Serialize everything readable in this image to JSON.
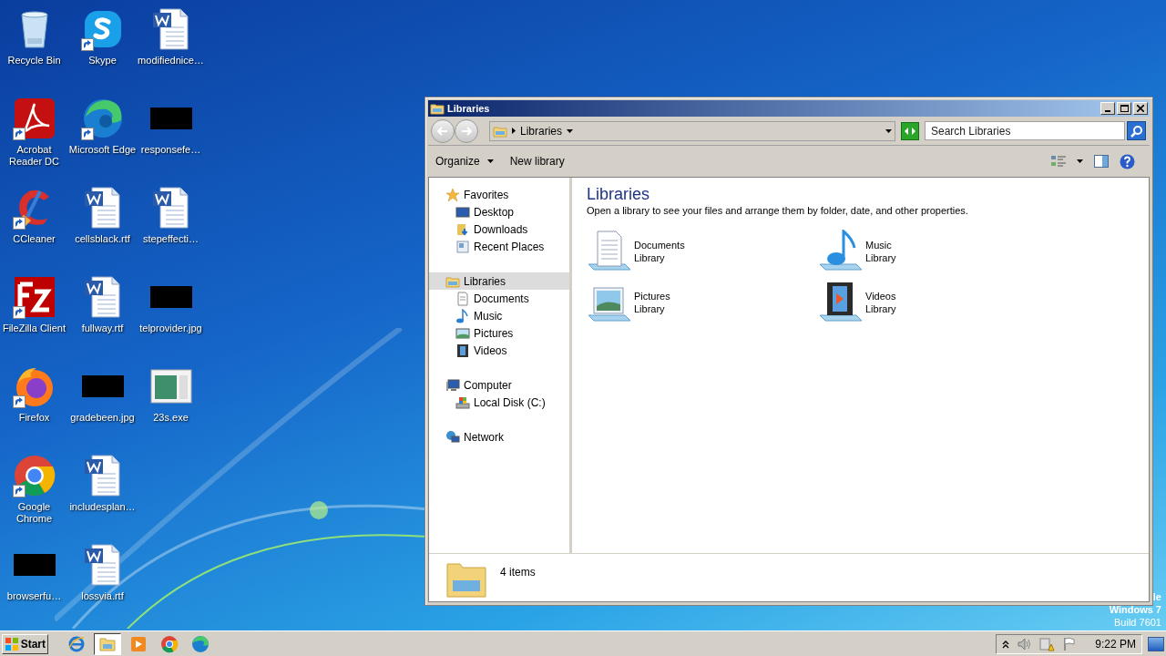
{
  "desktop": {
    "columns": [
      [
        {
          "label": "Recycle Bin",
          "kind": "recycle",
          "shortcut": false
        },
        {
          "label": "Acrobat Reader DC",
          "kind": "acrobat",
          "shortcut": true
        },
        {
          "label": "CCleaner",
          "kind": "ccleaner",
          "shortcut": true
        },
        {
          "label": "FileZilla Client",
          "kind": "filezilla",
          "shortcut": true
        },
        {
          "label": "Firefox",
          "kind": "firefox",
          "shortcut": true
        },
        {
          "label": "Google Chrome",
          "kind": "chrome",
          "shortcut": true
        },
        {
          "label": "browserfu…",
          "kind": "image",
          "shortcut": false
        }
      ],
      [
        {
          "label": "Skype",
          "kind": "skype",
          "shortcut": true
        },
        {
          "label": "Microsoft Edge",
          "kind": "edge",
          "shortcut": true
        },
        {
          "label": "cellsblack.rtf",
          "kind": "word",
          "shortcut": false
        },
        {
          "label": "fullway.rtf",
          "kind": "word",
          "shortcut": false
        },
        {
          "label": "gradebeen.jpg",
          "kind": "image",
          "shortcut": false
        },
        {
          "label": "includesplan…",
          "kind": "word",
          "shortcut": false
        },
        {
          "label": "lossvia.rtf",
          "kind": "word",
          "shortcut": false
        }
      ],
      [
        {
          "label": "modifiednice…",
          "kind": "word",
          "shortcut": false
        },
        {
          "label": "responsefe…",
          "kind": "image",
          "shortcut": false
        },
        {
          "label": "stepeffecti…",
          "kind": "word",
          "shortcut": false
        },
        {
          "label": "telprovider.jpg",
          "kind": "image",
          "shortcut": false
        },
        {
          "label": "23s.exe",
          "kind": "exe",
          "shortcut": false
        }
      ]
    ],
    "watermark": [
      "le",
      "Windows 7",
      "Build 7601"
    ]
  },
  "window": {
    "title": "Libraries",
    "address": {
      "crumbs": [
        "Libraries"
      ]
    },
    "search": {
      "placeholder": "Search Libraries"
    },
    "toolbar": [
      {
        "label": "Organize",
        "dropdown": true
      },
      {
        "label": "New library",
        "dropdown": false
      }
    ],
    "navigation": [
      {
        "label": "Favorites",
        "kind": "star",
        "selected": false,
        "children": [
          {
            "label": "Desktop",
            "kind": "desktop",
            "selected": false
          },
          {
            "label": "Downloads",
            "kind": "downloads",
            "selected": false
          },
          {
            "label": "Recent Places",
            "kind": "recent",
            "selected": false
          }
        ]
      },
      {
        "label": "Libraries",
        "kind": "library",
        "selected": true,
        "children": [
          {
            "label": "Documents",
            "kind": "document",
            "selected": false
          },
          {
            "label": "Music",
            "kind": "music",
            "selected": false
          },
          {
            "label": "Pictures",
            "kind": "pictures",
            "selected": false
          },
          {
            "label": "Videos",
            "kind": "videos",
            "selected": false
          }
        ]
      },
      {
        "label": "Computer",
        "kind": "computer",
        "selected": false,
        "children": [
          {
            "label": "Local Disk (C:)",
            "kind": "disk",
            "selected": false
          }
        ]
      },
      {
        "label": "Network",
        "kind": "network",
        "selected": false
      }
    ],
    "content": {
      "heading": "Libraries",
      "description": "Open a library to see your files and arrange them by folder, date, and other properties.",
      "libraries": [
        {
          "name": "Documents",
          "type": "Library",
          "kind": "document"
        },
        {
          "name": "Music",
          "type": "Library",
          "kind": "music"
        },
        {
          "name": "Pictures",
          "type": "Library",
          "kind": "pictures"
        },
        {
          "name": "Videos",
          "type": "Library",
          "kind": "videos"
        }
      ]
    },
    "details": {
      "count": "4 items"
    }
  },
  "taskbar": {
    "start": "Start",
    "apps": [
      {
        "kind": "ie",
        "selected": false
      },
      {
        "kind": "explorer",
        "selected": true
      },
      {
        "kind": "media",
        "selected": false
      },
      {
        "kind": "chrome",
        "selected": false
      },
      {
        "kind": "edge",
        "selected": false
      }
    ],
    "clock": "9:22 PM"
  }
}
